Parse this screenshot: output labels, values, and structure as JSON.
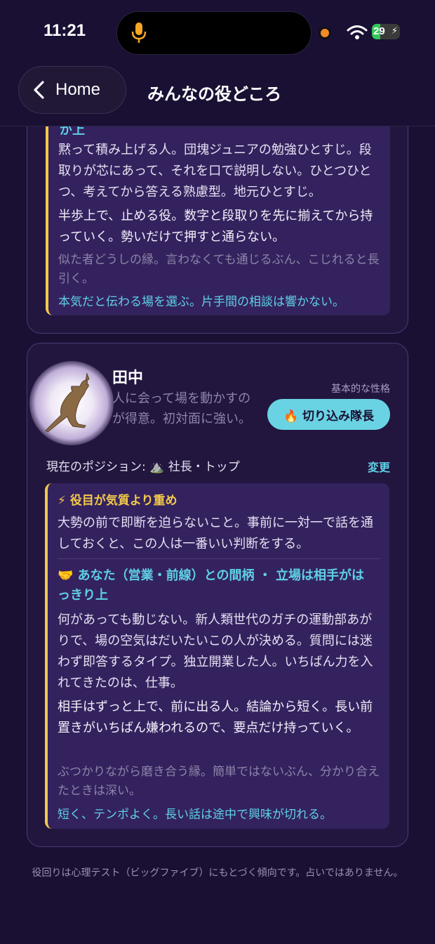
{
  "status": {
    "time": "11:21",
    "battery": "29"
  },
  "nav": {
    "back_label": "Home",
    "title": "みんなの役どころ"
  },
  "card1": {
    "partial_heading": "が上",
    "desc": "黙って積み上げる人。団塊ジュニアの勉強ひとすじ。段取りが芯にあって、それを口で説明しない。ひとつひとつ、考えてから答える熟慮型。地元ひとすじ。",
    "role": "半歩上で、止める役。数字と段取りを先に揃えてから持っていく。勢いだけで押すと通らない。",
    "note": "似た者どうしの縁。言わなくても通じるぶん、こじれると長引く。",
    "tip": "本気だと伝わる場を選ぶ。片手間の相談は響かない。"
  },
  "card2": {
    "name": "田中",
    "subtitle": "人に会って場を動かすのが得意。初対面に強い。",
    "trait_label": "基本的な性格",
    "trait_badge": "🔥 切り込み隊長",
    "position_label": "現在のポジション: ⛰️ 社長・トップ",
    "change_label": "変更",
    "warn_heading": "⚡ 役目が気質より重め",
    "warn_text": "大勢の前で即断を迫らないこと。事前に一対一で話を通しておくと、この人は一番いい判断をする。",
    "rel_heading_1": "🤝 あなた（営業・前線）との間柄 ・ 立場は相手がは",
    "rel_heading_2": "っきり上",
    "desc": "何があっても動じない。新人類世代のガチの運動部あがりで、場の空気はだいたいこの人が決める。質問には迷わず即答するタイプ。独立開業した人。いちばん力を入れてきたのは、仕事。",
    "role": "相手はずっと上で、前に出る人。結論から短く。長い前置きがいちばん嫌われるので、要点だけ持っていく。",
    "note": "ぶつかりながら磨き合う縁。簡単ではないぶん、分かり合えたときは深い。",
    "tip": "短く、テンポよく。長い話は途中で興味が切れる。"
  },
  "footer": "役回りは心理テスト（ビッグファイブ）にもとづく傾向です。占いではありません。",
  "colors": {
    "accent_cyan": "#5fd0e6",
    "accent_yellow": "#f2c94c",
    "bg": "#1a1033"
  }
}
